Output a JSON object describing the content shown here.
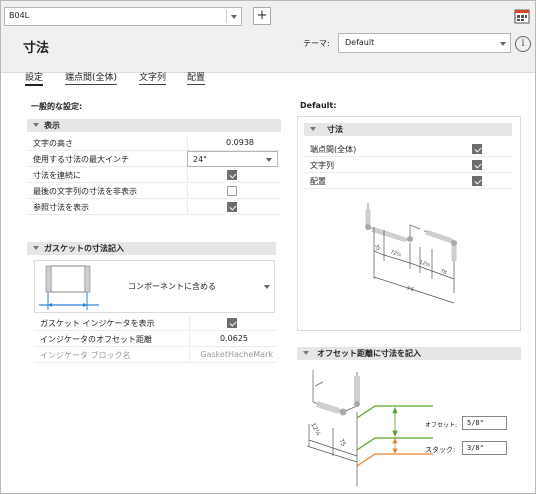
{
  "profile": {
    "selected": "B04L"
  },
  "page": {
    "title": "寸法"
  },
  "theme": {
    "label": "テーマ:",
    "selected": "Default"
  },
  "tabs": [
    {
      "label": "設定"
    },
    {
      "label": "端点間(全体)"
    },
    {
      "label": "文字列"
    },
    {
      "label": "配置"
    }
  ],
  "general": {
    "heading": "一般的な設定:",
    "display_group": {
      "title": "表示",
      "text_height": {
        "label": "文字の高さ",
        "value": "0.0938"
      },
      "max_inch": {
        "label": "使用する寸法の最大インチ",
        "value": "24\""
      },
      "continuous": {
        "label": "寸法を連続に",
        "checked": true
      },
      "hide_last": {
        "label": "最後の文字列の寸法を非表示",
        "checked": false
      },
      "show_ref": {
        "label": "参照寸法を表示",
        "checked": true
      }
    },
    "gasket_group": {
      "title": "ガスケットの寸法記入",
      "include_option": "コンポーネントに含める",
      "show_indicator": {
        "label": "ガスケット インジケータを表示",
        "checked": true
      },
      "indicator_offset": {
        "label": "インジケータのオフセット距離",
        "value": "0.0625"
      },
      "indicator_block": {
        "label": "インジケータ ブロック名",
        "value": "GasketHacheMark"
      }
    }
  },
  "defaults": {
    "heading": "Default:",
    "dim_group": {
      "title": "寸法",
      "items": [
        {
          "label": "端点間(全体)",
          "checked": true
        },
        {
          "label": "文字列",
          "checked": true
        },
        {
          "label": "配置",
          "checked": true
        }
      ]
    },
    "preview_labels": [
      "35",
      "72¼",
      "12¼",
      "78",
      "3'6"
    ]
  },
  "offset_section": {
    "title": "オフセット距離に寸法を記入",
    "offset_label": "オフセット:",
    "offset_value": "5/8\"",
    "stack_label": "スタック:",
    "stack_value": "3/8\"",
    "preview_labels": [
      "12¼",
      "75"
    ]
  },
  "colors": {
    "offset_green": "#5aa02c",
    "stack_orange": "#e8822a",
    "dim_blue": "#2a7fd4"
  },
  "icons": [
    "dropdown-icon",
    "add-icon",
    "tool-icon",
    "info-icon",
    "collapse-icon",
    "checkbox-icon"
  ]
}
